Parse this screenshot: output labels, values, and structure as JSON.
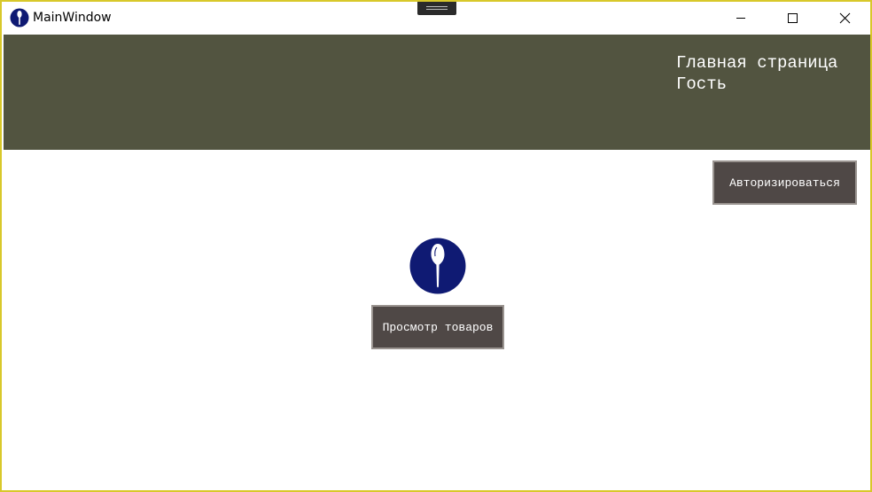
{
  "window": {
    "title": "MainWindow",
    "title_icon": "spoon-logo-icon",
    "controls": [
      "minimize-icon",
      "maximize-icon",
      "close-icon"
    ]
  },
  "header": {
    "title": "Главная страница",
    "role": "Гость",
    "background": "#525440"
  },
  "actions": {
    "authorize_label": "Авторизироваться",
    "view_products_label": "Просмотр товаров"
  },
  "logo": {
    "icon": "spoon-logo-icon",
    "color": "#0f1a73"
  },
  "colors": {
    "button_bg": "#4f4846",
    "button_border": "#9a9490",
    "window_border": "#d8c82a"
  }
}
